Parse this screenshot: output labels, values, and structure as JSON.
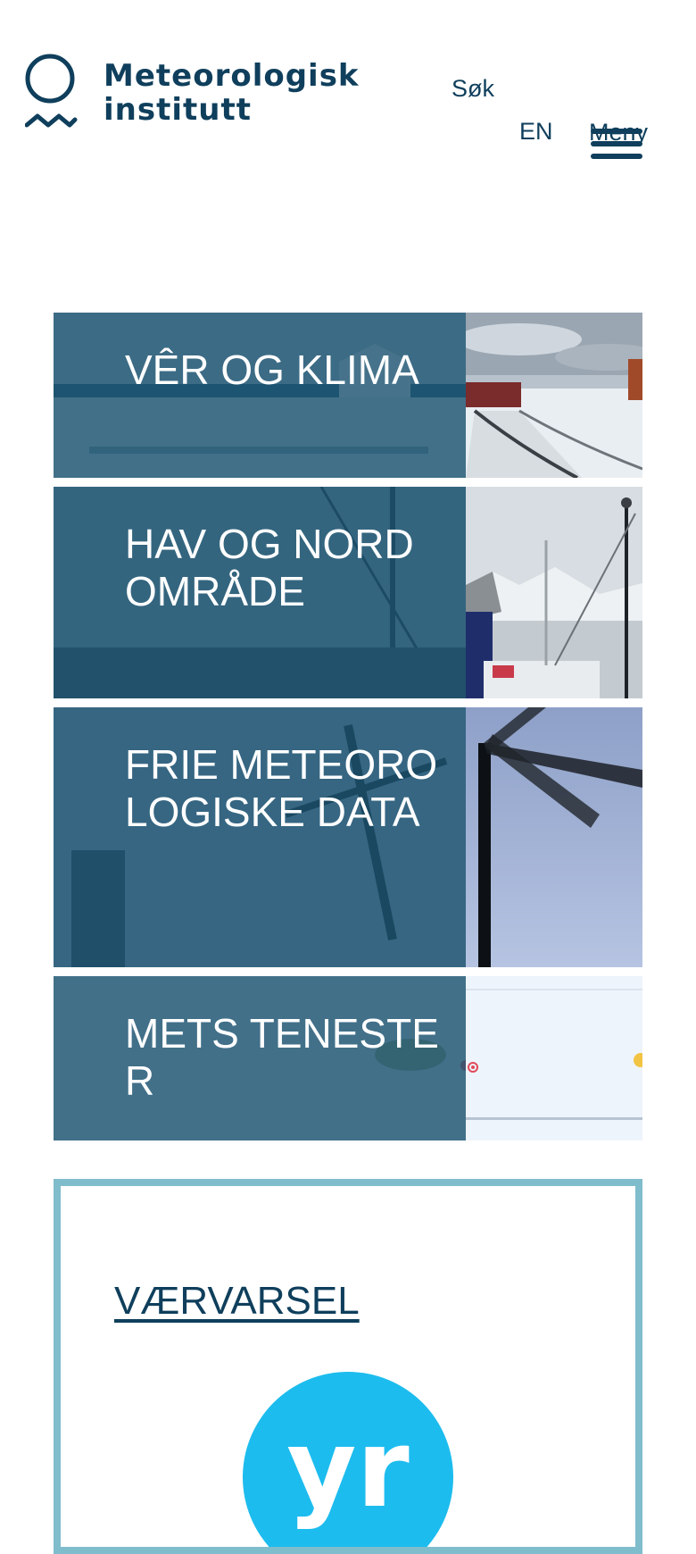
{
  "header": {
    "logo": {
      "line1": "Meteorologisk",
      "line2": "institutt",
      "icon": "sun-wave-logo-icon"
    },
    "search_label": "Søk",
    "language_label": "EN",
    "menu_label": "Meny",
    "menu_icon": "hamburger-icon"
  },
  "categories": [
    {
      "title": "VÊR OG KLIMA",
      "photo": "snowy-harbour-road-photo"
    },
    {
      "title": "HAV OG NORDOMRÅDE",
      "photo": "fishing-boat-mountains-photo"
    },
    {
      "title": "FRIE METEOROLOGISKE DATA",
      "photo": "wind-turbine-photo"
    },
    {
      "title": "METS TENESTER",
      "photo": "weather-map-photo"
    }
  ],
  "forecast": {
    "link_label": "VÆRVARSEL",
    "logo_text": "yr"
  },
  "colors": {
    "brand_dark": "#0f3f5c",
    "card_panel": "#1d5471",
    "box_border": "#7fbdcd",
    "yr_blue": "#1dbcef"
  }
}
